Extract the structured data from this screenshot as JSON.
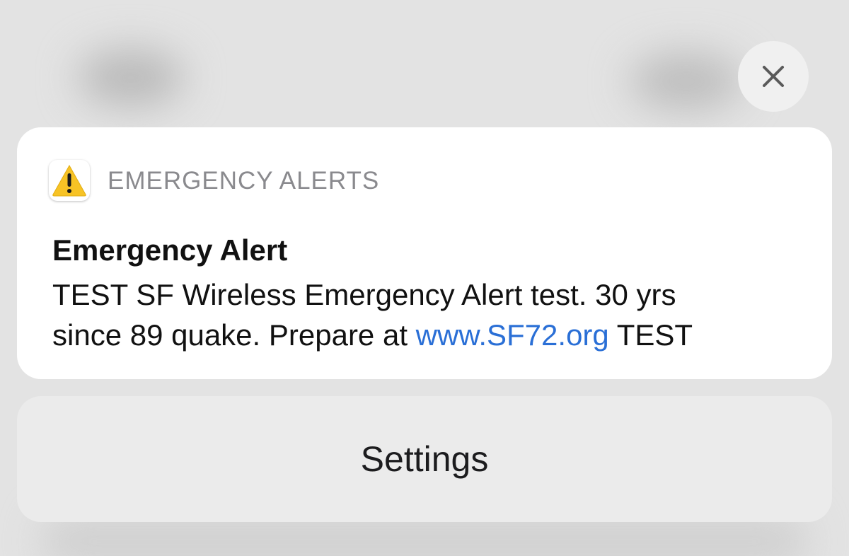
{
  "close_button": {
    "icon": "close-icon"
  },
  "notification": {
    "app_icon": "warning-icon",
    "app_name": "EMERGENCY ALERTS",
    "title": "Emergency Alert",
    "body_line1": "TEST SF Wireless Emergency Alert test. 30 yrs",
    "body_line2_before_link": "since 89 quake. Prepare at ",
    "link_text": "www.SF72.org",
    "body_line2_after_link": " TEST"
  },
  "settings": {
    "label": "Settings"
  },
  "colors": {
    "link": "#2a6fd6",
    "warning_yellow": "#f7c325",
    "card_background": "#ffffff",
    "backdrop": "#e3e3e3"
  }
}
